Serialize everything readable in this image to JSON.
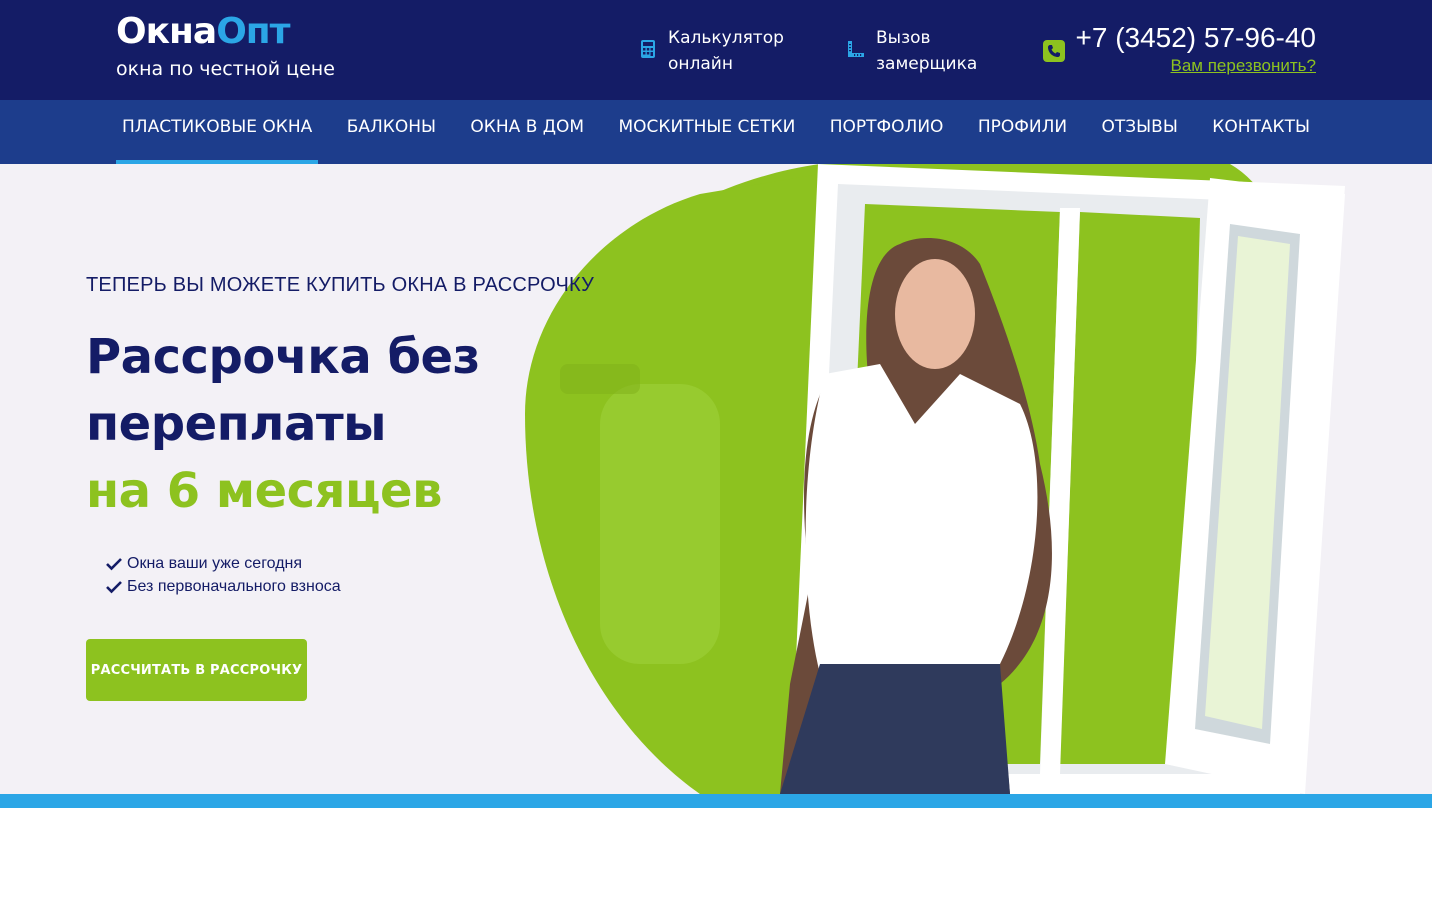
{
  "header": {
    "logo": {
      "part1": "Окна",
      "part2": "Опт",
      "tagline": "окна по честной цене"
    },
    "calculator": {
      "line1": "Калькулятор",
      "line2": "онлайн",
      "icon": "calculator-icon"
    },
    "measurer": {
      "line1": "Вызов",
      "line2": "замерщика",
      "icon": "ruler-icon"
    },
    "phone": {
      "number": "+7 (3452) 57-96-40",
      "callback": "Вам перезвонить?",
      "icon": "phone-icon"
    }
  },
  "nav": {
    "items": [
      {
        "label": "ПЛАСТИКОВЫЕ ОКНА"
      },
      {
        "label": "БАЛКОНЫ"
      },
      {
        "label": "ОКНА В ДОМ"
      },
      {
        "label": "МОСКИТНЫЕ СЕТКИ"
      },
      {
        "label": "ПОРТФОЛИО"
      },
      {
        "label": "ПРОФИЛИ"
      },
      {
        "label": "ОТЗЫВЫ"
      },
      {
        "label": "КОНТАКТЫ"
      }
    ],
    "active_index": 0
  },
  "hero": {
    "subtitle": "ТЕПЕРЬ ВЫ МОЖЕТЕ КУПИТЬ ОКНА В РАССРОЧКУ",
    "title_line1": "Рассрочка без",
    "title_line2": "переплаты",
    "title_line3": "на 6 месяцев",
    "benefits": [
      "Окна ваши уже сегодня",
      "Без первоначального взноса"
    ],
    "cta": "РАССЧИТАТЬ В РАССРОЧКУ"
  },
  "colors": {
    "header_bg": "#141c66",
    "nav_bg": "#1d3d8c",
    "accent_blue": "#2ba6e6",
    "accent_green": "#8dc21f",
    "hero_bg": "#f3f1f6"
  }
}
